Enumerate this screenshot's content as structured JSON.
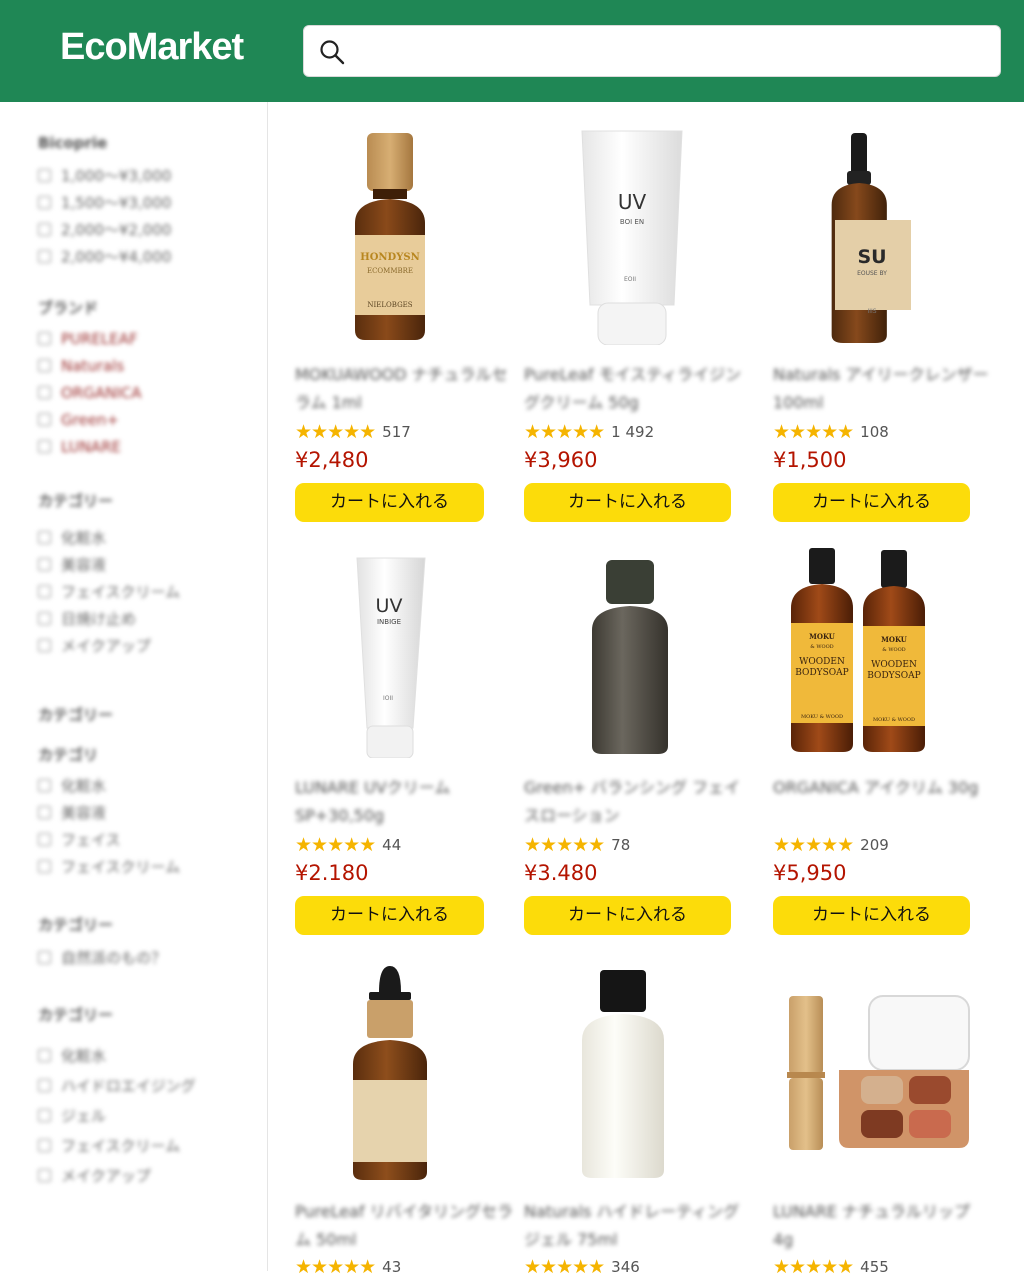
{
  "header": {
    "logo": "EcoMarket",
    "search": {
      "placeholder": "",
      "value": ""
    }
  },
  "sidebar": {
    "groups": [
      {
        "title": "Bicoprie",
        "items": [
          {
            "label": "1,000〜¥3,000"
          },
          {
            "label": "1,500〜¥3,000"
          },
          {
            "label": "2,000〜¥2,000"
          },
          {
            "label": "2,000〜¥4,000"
          }
        ]
      },
      {
        "title": "ブランド",
        "items": [
          {
            "label": "PURELEAF"
          },
          {
            "label": "Naturals"
          },
          {
            "label": "ORGANICA"
          },
          {
            "label": "Green+"
          },
          {
            "label": "LUNARE"
          }
        ]
      },
      {
        "title": "カテゴリー",
        "items": [
          {
            "label": "化粧水"
          },
          {
            "label": "美容液"
          },
          {
            "label": "フェイスクリーム"
          },
          {
            "label": "日焼け止め"
          },
          {
            "label": "メイクアップ"
          }
        ]
      },
      {
        "title": "カテゴリー",
        "subtitle": "カテゴリ",
        "items": [
          {
            "label": "化粧水"
          },
          {
            "label": "美容液"
          },
          {
            "label": "フェイス"
          },
          {
            "label": "フェイスクリーム"
          }
        ]
      },
      {
        "title": "カテゴリー",
        "items": [
          {
            "label": "自然派のもの？"
          }
        ]
      },
      {
        "title": "カテゴリー",
        "items": [
          {
            "label": "化粧水"
          },
          {
            "label": "ハイドロエイジング"
          },
          {
            "label": "ジェル"
          },
          {
            "label": "フェイスクリーム"
          },
          {
            "label": "メイクアップ"
          }
        ]
      }
    ]
  },
  "products": [
    {
      "name": "MOKUAWOOD ナチュラルセラム 1ml",
      "stars": "★★★★★",
      "reviews": "517",
      "price": "¥2,480",
      "cart": "カートに入れる",
      "image": "amber-bottle-icon",
      "img_label1": "HONDYSN",
      "img_label2": "ECOMMBRE",
      "img_label3": "NIELOBGES"
    },
    {
      "name": "PureLeaf モイスティライジングクリーム 50g",
      "stars": "★★★★★",
      "reviews": "1 492",
      "price": "¥3,960",
      "cart": "カートに入れる",
      "image": "white-tube-icon",
      "img_label1": "UV",
      "img_label2": "BOI EN",
      "img_label3": "EOII"
    },
    {
      "name": "Naturals アイリークレンザー 100ml",
      "stars": "★★★★★",
      "reviews": "108",
      "price": "¥1,500",
      "cart": "カートに入れる",
      "image": "pump-bottle-icon",
      "img_label1": "SU",
      "img_label2": "EOUSE BY",
      "img_label3": "IIIS"
    },
    {
      "name": "LUNARE UVクリーム SP+30,50g",
      "stars": "★★★★★",
      "reviews": "44",
      "price": "¥2.180",
      "cart": "カートに入れる",
      "image": "uv-tube-icon",
      "img_label1": "UV",
      "img_label2": "INBIGE",
      "img_label3": "IOII"
    },
    {
      "name": "Green+ バランシング フェイスローション",
      "stars": "★★★★★",
      "reviews": "78",
      "price": "¥3.480",
      "cart": "カートに入れる",
      "image": "olive-bottle-icon"
    },
    {
      "name": "ORGANICA アイクリム 30g",
      "stars": "★★★★★",
      "reviews": "209",
      "price": "¥5,950",
      "cart": "カートに入れる",
      "image": "bodysoap-bottles-icon",
      "img_label1": "MOKU",
      "img_label2": "& WOOD",
      "img_label3": "WOODEN",
      "img_label4": "BODYSOAP",
      "img_label5": "MOKU & WOOD"
    },
    {
      "name": "PureLeaf リバイタリングセラム 50ml",
      "stars": "★★★★★",
      "reviews": "43",
      "price": "",
      "cart": "",
      "image": "dropper-bottle-icon"
    },
    {
      "name": "Naturals ハイドレーティングジェル 75ml",
      "stars": "★★★★★",
      "reviews": "346",
      "price": "",
      "cart": "",
      "image": "white-bottle-icon"
    },
    {
      "name": "LUNARE ナチュラルリップ 4g",
      "stars": "★★★★★",
      "reviews": "455",
      "price": "",
      "cart": "",
      "image": "lipstick-palette-icon"
    }
  ],
  "colors": {
    "header": "#1f8755",
    "cart_button": "#fcdc0a",
    "price": "#b41400",
    "star": "#f5b400"
  }
}
